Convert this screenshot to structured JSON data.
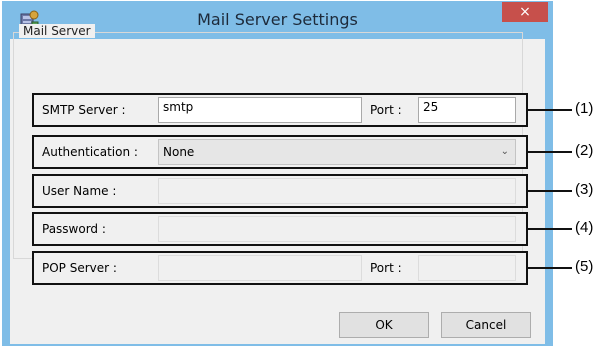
{
  "window": {
    "title": "Mail Server Settings",
    "close_glyph": "×",
    "colors": {
      "title_bar": "#7fbde7",
      "close_button": "#c7504b",
      "client": "#f0f0f0"
    }
  },
  "group": {
    "label": "Mail Server"
  },
  "smtp": {
    "label": "SMTP Server :",
    "value": "smtp",
    "port_label": "Port :",
    "port_value": "25"
  },
  "auth": {
    "label": "Authentication :",
    "value": "None"
  },
  "user": {
    "label": "User Name :",
    "value": ""
  },
  "password": {
    "label": "Password :",
    "value": ""
  },
  "pop": {
    "label": "POP Server :",
    "value": "",
    "port_label": "Port :",
    "port_value": ""
  },
  "buttons": {
    "ok": "OK",
    "cancel": "Cancel"
  },
  "callouts": [
    "(1)",
    "(2)",
    "(3)",
    "(4)",
    "(5)"
  ],
  "icons": {
    "title": "app-icon",
    "combo": "chevron-down-icon",
    "close": "close-icon"
  }
}
